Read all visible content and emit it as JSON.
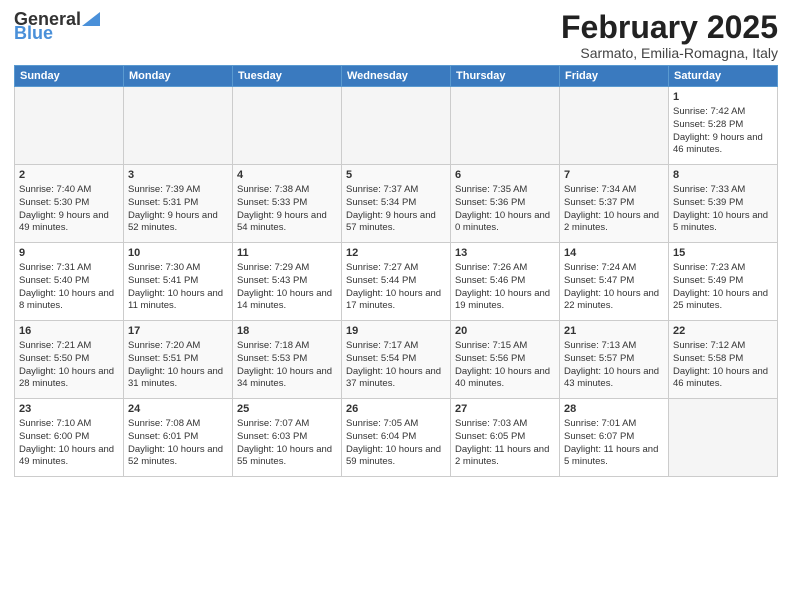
{
  "logo": {
    "general": "General",
    "blue": "Blue"
  },
  "title": "February 2025",
  "subtitle": "Sarmato, Emilia-Romagna, Italy",
  "days": [
    "Sunday",
    "Monday",
    "Tuesday",
    "Wednesday",
    "Thursday",
    "Friday",
    "Saturday"
  ],
  "weeks": [
    [
      {
        "day": "",
        "info": ""
      },
      {
        "day": "",
        "info": ""
      },
      {
        "day": "",
        "info": ""
      },
      {
        "day": "",
        "info": ""
      },
      {
        "day": "",
        "info": ""
      },
      {
        "day": "",
        "info": ""
      },
      {
        "day": "1",
        "info": "Sunrise: 7:42 AM\nSunset: 5:28 PM\nDaylight: 9 hours and 46 minutes."
      }
    ],
    [
      {
        "day": "2",
        "info": "Sunrise: 7:40 AM\nSunset: 5:30 PM\nDaylight: 9 hours and 49 minutes."
      },
      {
        "day": "3",
        "info": "Sunrise: 7:39 AM\nSunset: 5:31 PM\nDaylight: 9 hours and 52 minutes."
      },
      {
        "day": "4",
        "info": "Sunrise: 7:38 AM\nSunset: 5:33 PM\nDaylight: 9 hours and 54 minutes."
      },
      {
        "day": "5",
        "info": "Sunrise: 7:37 AM\nSunset: 5:34 PM\nDaylight: 9 hours and 57 minutes."
      },
      {
        "day": "6",
        "info": "Sunrise: 7:35 AM\nSunset: 5:36 PM\nDaylight: 10 hours and 0 minutes."
      },
      {
        "day": "7",
        "info": "Sunrise: 7:34 AM\nSunset: 5:37 PM\nDaylight: 10 hours and 2 minutes."
      },
      {
        "day": "8",
        "info": "Sunrise: 7:33 AM\nSunset: 5:39 PM\nDaylight: 10 hours and 5 minutes."
      }
    ],
    [
      {
        "day": "9",
        "info": "Sunrise: 7:31 AM\nSunset: 5:40 PM\nDaylight: 10 hours and 8 minutes."
      },
      {
        "day": "10",
        "info": "Sunrise: 7:30 AM\nSunset: 5:41 PM\nDaylight: 10 hours and 11 minutes."
      },
      {
        "day": "11",
        "info": "Sunrise: 7:29 AM\nSunset: 5:43 PM\nDaylight: 10 hours and 14 minutes."
      },
      {
        "day": "12",
        "info": "Sunrise: 7:27 AM\nSunset: 5:44 PM\nDaylight: 10 hours and 17 minutes."
      },
      {
        "day": "13",
        "info": "Sunrise: 7:26 AM\nSunset: 5:46 PM\nDaylight: 10 hours and 19 minutes."
      },
      {
        "day": "14",
        "info": "Sunrise: 7:24 AM\nSunset: 5:47 PM\nDaylight: 10 hours and 22 minutes."
      },
      {
        "day": "15",
        "info": "Sunrise: 7:23 AM\nSunset: 5:49 PM\nDaylight: 10 hours and 25 minutes."
      }
    ],
    [
      {
        "day": "16",
        "info": "Sunrise: 7:21 AM\nSunset: 5:50 PM\nDaylight: 10 hours and 28 minutes."
      },
      {
        "day": "17",
        "info": "Sunrise: 7:20 AM\nSunset: 5:51 PM\nDaylight: 10 hours and 31 minutes."
      },
      {
        "day": "18",
        "info": "Sunrise: 7:18 AM\nSunset: 5:53 PM\nDaylight: 10 hours and 34 minutes."
      },
      {
        "day": "19",
        "info": "Sunrise: 7:17 AM\nSunset: 5:54 PM\nDaylight: 10 hours and 37 minutes."
      },
      {
        "day": "20",
        "info": "Sunrise: 7:15 AM\nSunset: 5:56 PM\nDaylight: 10 hours and 40 minutes."
      },
      {
        "day": "21",
        "info": "Sunrise: 7:13 AM\nSunset: 5:57 PM\nDaylight: 10 hours and 43 minutes."
      },
      {
        "day": "22",
        "info": "Sunrise: 7:12 AM\nSunset: 5:58 PM\nDaylight: 10 hours and 46 minutes."
      }
    ],
    [
      {
        "day": "23",
        "info": "Sunrise: 7:10 AM\nSunset: 6:00 PM\nDaylight: 10 hours and 49 minutes."
      },
      {
        "day": "24",
        "info": "Sunrise: 7:08 AM\nSunset: 6:01 PM\nDaylight: 10 hours and 52 minutes."
      },
      {
        "day": "25",
        "info": "Sunrise: 7:07 AM\nSunset: 6:03 PM\nDaylight: 10 hours and 55 minutes."
      },
      {
        "day": "26",
        "info": "Sunrise: 7:05 AM\nSunset: 6:04 PM\nDaylight: 10 hours and 59 minutes."
      },
      {
        "day": "27",
        "info": "Sunrise: 7:03 AM\nSunset: 6:05 PM\nDaylight: 11 hours and 2 minutes."
      },
      {
        "day": "28",
        "info": "Sunrise: 7:01 AM\nSunset: 6:07 PM\nDaylight: 11 hours and 5 minutes."
      },
      {
        "day": "",
        "info": ""
      }
    ]
  ]
}
